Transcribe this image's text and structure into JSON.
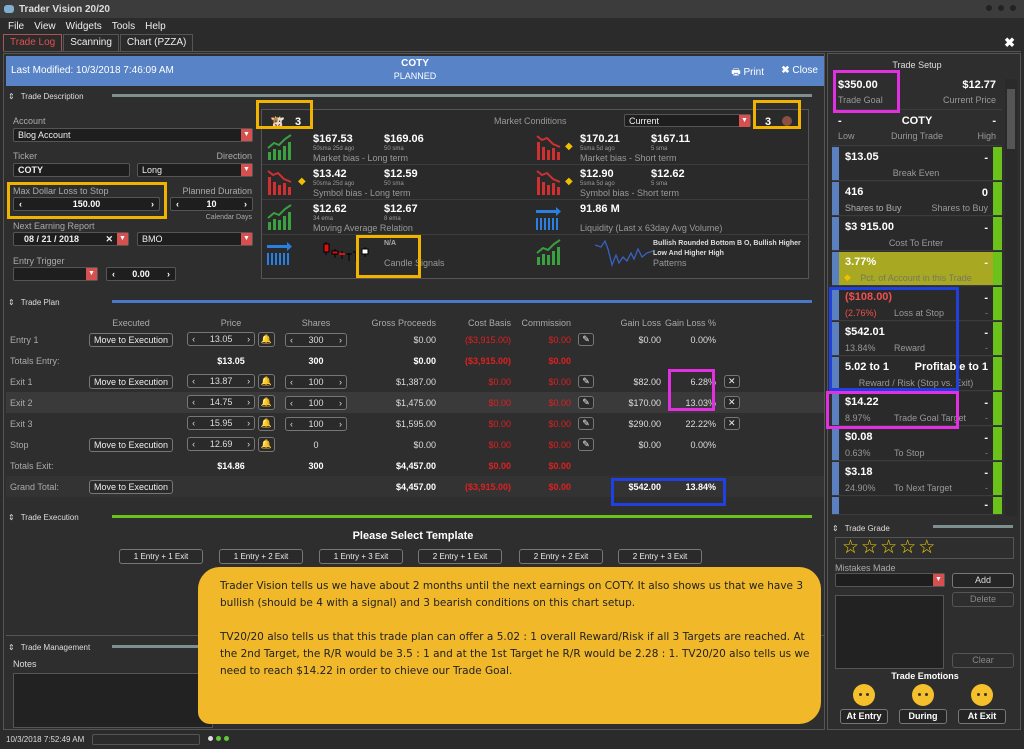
{
  "app": {
    "title": "Trader Vision 20/20"
  },
  "menu": [
    "File",
    "View",
    "Widgets",
    "Tools",
    "Help"
  ],
  "tabs": [
    "Trade Log",
    "Scanning",
    "Chart (PZZA)"
  ],
  "header": {
    "last_modified": "Last Modified: 10/3/2018 7:46:09 AM",
    "ticker": "COTY",
    "status": "PLANNED",
    "print": "Print",
    "close": "Close"
  },
  "trade_description": {
    "section_title": "Trade Description",
    "account_label": "Account",
    "account_value": "Blog Account",
    "ticker_label": "Ticker",
    "ticker_value": "COTY",
    "direction_label": "Direction",
    "direction_value": "Long",
    "max_loss_label": "Max Dollar Loss to Stop",
    "max_loss_value": "150.00",
    "duration_label": "Planned Duration",
    "duration_value": "10",
    "duration_unit": "Calendar Days",
    "earnings_label": "Next Earning Report",
    "earnings_value": "08 / 21 / 2018",
    "earnings_timing": "BMO",
    "entry_trigger_label": "Entry Trigger",
    "entry_trigger_value": "0.00"
  },
  "market_conditions": {
    "label": "Market Conditions",
    "dropdown": "Current",
    "bullish_count": "3",
    "bearish_count": "3",
    "left": [
      {
        "v1": "$167.53",
        "s1": "50sma 25d ago",
        "v2": "$169.06",
        "s2": "50 sma",
        "desc": "Market bias - Long term"
      },
      {
        "v1": "$13.42",
        "s1": "50sma 25d ago",
        "v2": "$12.59",
        "s2": "50 sma",
        "desc": "Symbol bias - Long term"
      },
      {
        "v1": "$12.62",
        "s1": "34 ema",
        "v2": "$12.67",
        "s2": "8 ema",
        "desc": "Moving Average Relation"
      },
      {
        "v1": "N/A",
        "desc": "Candle Signals"
      }
    ],
    "right": [
      {
        "v1": "$170.21",
        "s1": "5sma 5d ago",
        "v2": "$167.11",
        "s2": "5 sma",
        "desc": "Market bias - Short term"
      },
      {
        "v1": "$12.90",
        "s1": "5sma 5d ago",
        "v2": "$12.62",
        "s2": "5 sma",
        "desc": "Symbol bias - Short term"
      },
      {
        "v1": "91.86 M",
        "desc": "Liquidity (Last x 63day Avg Volume)"
      },
      {
        "v1": "Bullish Rounded Bottom B O, Bullish Higher Low And Higher High",
        "desc": "Patterns"
      }
    ]
  },
  "trade_plan": {
    "section_title": "Trade Plan",
    "columns": [
      "Executed",
      "Price",
      "Shares",
      "Gross Proceeds",
      "Cost Basis",
      "Commission",
      "Gain Loss",
      "Gain Loss %"
    ],
    "move_btn": "Move to Execution",
    "rows": [
      {
        "label": "Entry 1",
        "price": "13.05",
        "shares": "300",
        "gross": "$0.00",
        "cost": "($3,915.00)",
        "comm": "$0.00",
        "gl": "$0.00",
        "glp": "0.00%"
      },
      {
        "label": "Totals Entry:",
        "price": "$13.05",
        "shares": "300",
        "gross": "$0.00",
        "cost": "($3,915.00)",
        "comm": "$0.00"
      },
      {
        "label": "Exit 1",
        "price": "13.87",
        "shares": "100",
        "gross": "$1,387.00",
        "cost": "$0.00",
        "comm": "$0.00",
        "gl": "$82.00",
        "glp": "6.28%"
      },
      {
        "label": "Exit 2",
        "price": "14.75",
        "shares": "100",
        "gross": "$1,475.00",
        "cost": "$0.00",
        "comm": "$0.00",
        "gl": "$170.00",
        "glp": "13.03%"
      },
      {
        "label": "Exit 3",
        "price": "15.95",
        "shares": "100",
        "gross": "$1,595.00",
        "cost": "$0.00",
        "comm": "$0.00",
        "gl": "$290.00",
        "glp": "22.22%"
      },
      {
        "label": "Stop",
        "price": "12.69",
        "shares": "0",
        "gross": "$0.00",
        "cost": "$0.00",
        "comm": "$0.00",
        "gl": "$0.00",
        "glp": "0.00%"
      },
      {
        "label": "Totals Exit:",
        "price": "$14.86",
        "shares": "300",
        "gross": "$4,457.00",
        "cost": "$0.00",
        "comm": "$0.00"
      },
      {
        "label": "Grand Total:",
        "gross": "$4,457.00",
        "cost": "($3,915.00)",
        "comm": "$0.00",
        "gl": "$542.00",
        "glp": "13.84%"
      }
    ]
  },
  "trade_execution": {
    "section_title": "Trade Execution",
    "prompt": "Please Select Template",
    "templates": [
      "1 Entry + 1 Exit",
      "1 Entry + 2 Exit",
      "1 Entry + 3 Exit",
      "2 Entry + 1 Exit",
      "2 Entry + 2 Exit",
      "2 Entry + 3 Exit"
    ]
  },
  "trade_management": {
    "section_title": "Trade Management",
    "notes_label": "Notes"
  },
  "callout": {
    "p1": "Trader Vision tells us we have about 2 months until the next earnings on COTY.  It also shows us that we have 3 bullish (should be 4 with a signal) and 3 bearish conditions on this chart setup.",
    "p2": "TV20/20 also tells us that this trade plan can offer a 5.02 : 1 overall Reward/Risk if all 3 Targets are reached.  At the 2nd Target, the R/R would be 3.5 : 1 and at the 1st Target he R/R would be 2.28 : 1.  TV20/20 also tells us we need to reach $14.22 in order to chieve our Trade Goal."
  },
  "trade_setup": {
    "title": "Trade Setup",
    "goal": "$350.00",
    "goal_label": "Trade Goal",
    "price": "$12.77",
    "price_label": "Current Price",
    "low": "-",
    "low_label": "Low",
    "ticker": "COTY",
    "during_label": "During Trade",
    "high": "-",
    "high_label": "High",
    "items": [
      {
        "big": "$13.05",
        "label": "Break Even",
        "right": "-"
      },
      {
        "big": "416",
        "sub": "Shares to Buy",
        "label2": "Shares to Buy",
        "right": "0"
      },
      {
        "big": "$3 915.00",
        "label": "Cost To Enter",
        "right": "-"
      },
      {
        "big": "3.77%",
        "label": "Pct. of Account in this Trade",
        "right": "-"
      },
      {
        "big": "($108.00)",
        "sub": "(2.76%)",
        "label": "Loss at Stop",
        "right": "-"
      },
      {
        "big": "$542.01",
        "sub": "13.84%",
        "label": "Reward",
        "right": "-"
      },
      {
        "big": "5.02 to 1",
        "big2": "Profitable to 1",
        "label": "Reward / Risk (Stop vs. Exit)"
      },
      {
        "big": "$14.22",
        "sub": "8.97%",
        "label": "Trade Goal Target",
        "right": "-"
      },
      {
        "big": "$0.08",
        "sub": "0.63%",
        "label": "To Stop",
        "right": "-"
      },
      {
        "big": "$3.18",
        "sub": "24.90%",
        "label": "To Next Target",
        "right": "-"
      }
    ]
  },
  "trade_grade": {
    "section_title": "Trade Grade",
    "stars": 5,
    "rating": 0,
    "mistakes_label": "Mistakes Made",
    "add": "Add",
    "delete": "Delete",
    "clear": "Clear",
    "emotions_label": "Trade Emotions",
    "emotions": [
      "At Entry",
      "During",
      "At Exit"
    ]
  },
  "status": {
    "timestamp": "10/3/2018 7:52:49 AM"
  }
}
